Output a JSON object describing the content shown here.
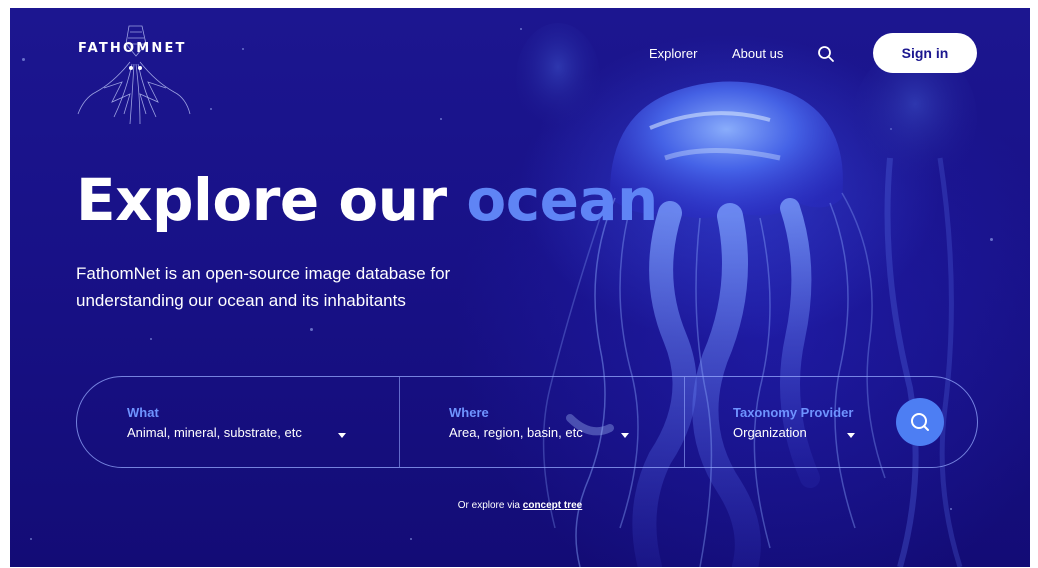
{
  "brand": {
    "name": "FathomNet"
  },
  "nav": {
    "explorer_label": "Explorer",
    "about_label": "About us",
    "search_icon": "search-icon",
    "signin_label": "Sign in"
  },
  "hero": {
    "title_main": "Explore our ",
    "title_accent": "ocean",
    "subtitle": "FathomNet is an open-source image database for understanding our ocean and its inhabitants"
  },
  "search": {
    "what": {
      "label": "What",
      "value": "Animal, mineral, substrate, etc"
    },
    "where": {
      "label": "Where",
      "value": "Area, region, basin, etc"
    },
    "taxonomy": {
      "label": "Taxonomy Provider",
      "value": "Organization"
    },
    "submit_icon": "search-icon"
  },
  "footer": {
    "explore_prefix": "Or explore via ",
    "explore_link": "concept tree"
  },
  "colors": {
    "background": "#181187",
    "accent": "#5f84f5",
    "label_blue": "#6f93ff",
    "button_blue": "#4d7ef3",
    "signin_text": "#1b168f"
  }
}
